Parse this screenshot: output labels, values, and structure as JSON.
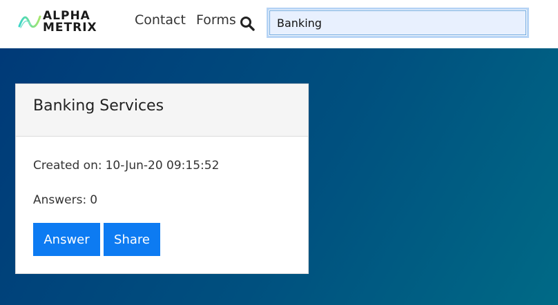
{
  "brand": {
    "line1": "ALPHA",
    "line2": "METRIX",
    "logo_icon": "alphametrix-wave-logo",
    "colors": {
      "wave_start": "#3ad5c8",
      "wave_end": "#a8e66b"
    }
  },
  "nav": {
    "items": [
      {
        "label": "Contact"
      },
      {
        "label": "Forms"
      }
    ],
    "search_icon": "search-icon"
  },
  "search": {
    "value": "Banking",
    "placeholder": ""
  },
  "card": {
    "title": "Banking Services",
    "created_label": "Created on:",
    "created_value": "10-Jun-20 09:15:52",
    "answers_label": "Answers:",
    "answers_value": "0",
    "buttons": {
      "answer": "Answer",
      "share": "Share"
    }
  },
  "colors": {
    "primary_button": "#0d7bf2",
    "hero_gradient_start": "#003a78",
    "hero_gradient_end": "#006a86",
    "search_focus": "#b7d4f5"
  }
}
